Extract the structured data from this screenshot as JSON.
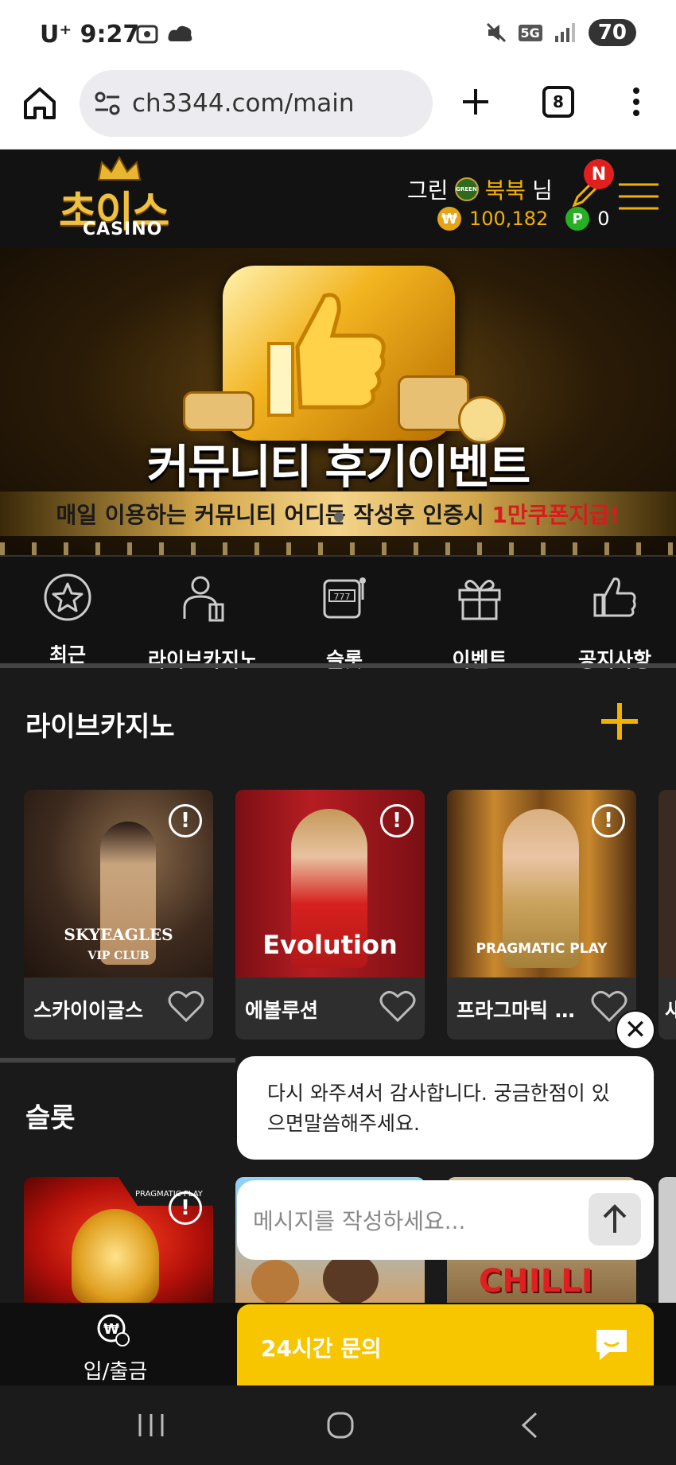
{
  "status_bar": {
    "carrier": "U⁺",
    "time": "9:27",
    "network": "5G",
    "battery": "70"
  },
  "browser": {
    "url": "ch3344.com/main",
    "tab_count": "8"
  },
  "header": {
    "logo_text": "초이스",
    "logo_subtext": "CASINO",
    "user_prefix": "그린",
    "level_badge": "GREEN",
    "username": "북북",
    "user_suffix": "님",
    "notification_badge": "N",
    "currency_symbol": "₩",
    "balance": "100,182",
    "points_symbol": "P",
    "points": "0"
  },
  "banner": {
    "title": "커뮤니티 후기이벤트",
    "subtitle_prefix": "매일 이용하는 커뮤니티 어디든 작성후 인증시 ",
    "subtitle_highlight": "1만쿠폰지급!"
  },
  "categories": [
    {
      "label": "최근",
      "icon": "star-icon"
    },
    {
      "label": "라이브카지노",
      "icon": "dealer-icon"
    },
    {
      "label": "슬롯",
      "icon": "slot-machine-icon"
    },
    {
      "label": "이벤트",
      "icon": "gift-icon"
    },
    {
      "label": "공지사항",
      "icon": "thumbs-up-icon"
    }
  ],
  "live_casino": {
    "title": "라이브카지노",
    "games": [
      {
        "name": "스카이이글스",
        "logo": "SKYEAGLES",
        "logo_sub": "VIP CLUB"
      },
      {
        "name": "에볼루션",
        "logo": "Evolution"
      },
      {
        "name": "프라그마틱 카지노",
        "logo": "PRAGMATIC PLAY"
      }
    ],
    "partial_next_label": "섀"
  },
  "slots": {
    "title": "슬롯",
    "first_tag": "PRAGMATIC PLAY",
    "third_game_text": "CHILLI"
  },
  "chat": {
    "message": "다시 와주셔서 감사합니다. 궁금한점이 있으면말씀해주세요.",
    "input_placeholder": "메시지를 작성하세요..."
  },
  "bottom_bar": {
    "deposit_label": "입/출금",
    "inquiry_label": "24시간 문의"
  },
  "colors": {
    "accent": "#f2b100",
    "inquiry_yellow": "#f7c600",
    "background": "#1a1a1a"
  }
}
